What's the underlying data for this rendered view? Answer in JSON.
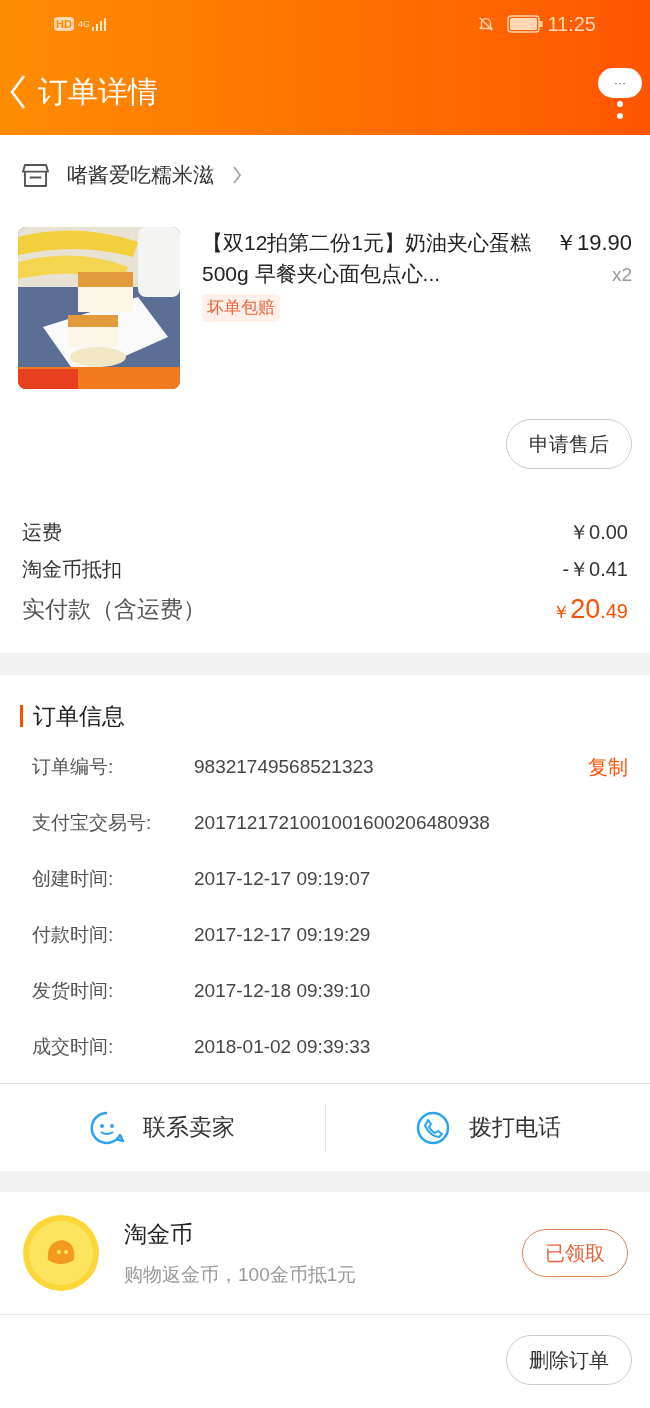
{
  "status_bar": {
    "hd": "HD",
    "network": "4G",
    "time": "11:25"
  },
  "header": {
    "title": "订单详情",
    "more": "···"
  },
  "shop": {
    "name": "啫酱爱吃糯米滋"
  },
  "item": {
    "title": "【双12拍第二份1元】奶油夹心蛋糕500g  早餐夹心面包点心...",
    "price": "￥19.90",
    "quantity": "x2",
    "tag": "坏单包赔"
  },
  "after_sale_button": "申请售后",
  "fees": [
    {
      "label": "运费",
      "value": "￥0.00"
    },
    {
      "label": "淘金币抵扣",
      "value": "-￥0.41"
    }
  ],
  "total": {
    "label": "实付款（含运费）",
    "currency": "￥",
    "integer": "20",
    "decimal": ".49"
  },
  "order_info": {
    "title": "订单信息",
    "rows": [
      {
        "label": "订单编号:",
        "value": "98321749568521323",
        "action": "复制"
      },
      {
        "label": "支付宝交易号:",
        "value": "2017121721001001600206480938"
      },
      {
        "label": "创建时间:",
        "value": "2017-12-17 09:19:07"
      },
      {
        "label": "付款时间:",
        "value": "2017-12-17 09:19:29"
      },
      {
        "label": "发货时间:",
        "value": "2017-12-18 09:39:10"
      },
      {
        "label": "成交时间:",
        "value": "2018-01-02 09:39:33"
      }
    ]
  },
  "contact": [
    {
      "kind": "chat",
      "label": "联系卖家"
    },
    {
      "kind": "phone",
      "label": "拨打电话"
    }
  ],
  "coins": {
    "title": "淘金币",
    "subtitle": "购物返金币，100金币抵1元",
    "button": "已领取"
  },
  "delete_button": "删除订单"
}
